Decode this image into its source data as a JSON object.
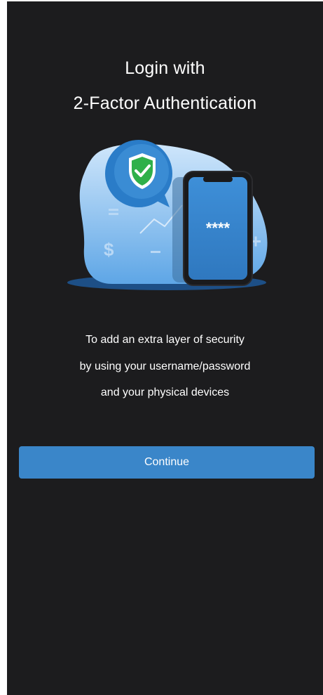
{
  "header": {
    "title_line1": "Login with",
    "title_line2": "2-Factor Authentication"
  },
  "illustration": {
    "masked_pin": "****",
    "icons": [
      "shield-check-icon",
      "smartphone-icon",
      "dollar-icon",
      "chart-line-icon"
    ]
  },
  "description": {
    "line1": "To add an extra layer of security",
    "line2": "by using your username/password",
    "line3": "and your physical devices"
  },
  "actions": {
    "continue_label": "Continue"
  },
  "colors": {
    "background": "#1c1c1e",
    "accent": "#3a86c9",
    "shield": "#2fb04a"
  }
}
